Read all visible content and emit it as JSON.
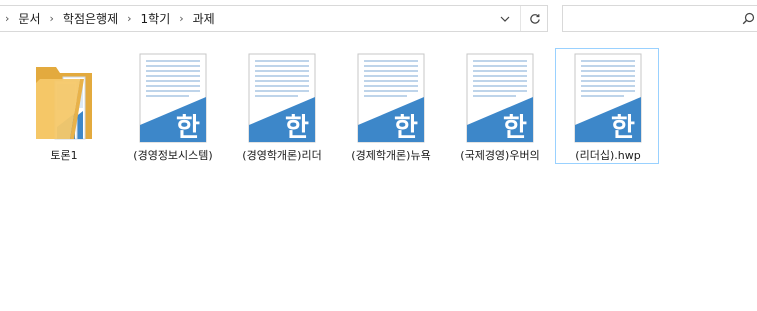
{
  "address": {
    "breadcrumbs": [
      "문서",
      "학점은행제",
      "1학기",
      "과제"
    ]
  },
  "search": {
    "placeholder": ""
  },
  "files": [
    {
      "name": "토론1",
      "type": "folder"
    },
    {
      "name": "(경영정보시스템)",
      "type": "hwp"
    },
    {
      "name": "(경영학개론)리더",
      "type": "hwp"
    },
    {
      "name": "(경제학개론)뉴욕",
      "type": "hwp"
    },
    {
      "name": "(국제경영)우버의",
      "type": "hwp"
    },
    {
      "name": "(리더십).hwp",
      "type": "hwp"
    }
  ],
  "colors": {
    "hwp_blue": "#3d87c9",
    "doc_line": "#a9c6e3",
    "folder": "#f5c869",
    "selection_border": "#99d1ff"
  },
  "icons": {
    "folder": "folder-icon",
    "hwp": "hwp-document-icon",
    "hwp_glyph": "한"
  }
}
